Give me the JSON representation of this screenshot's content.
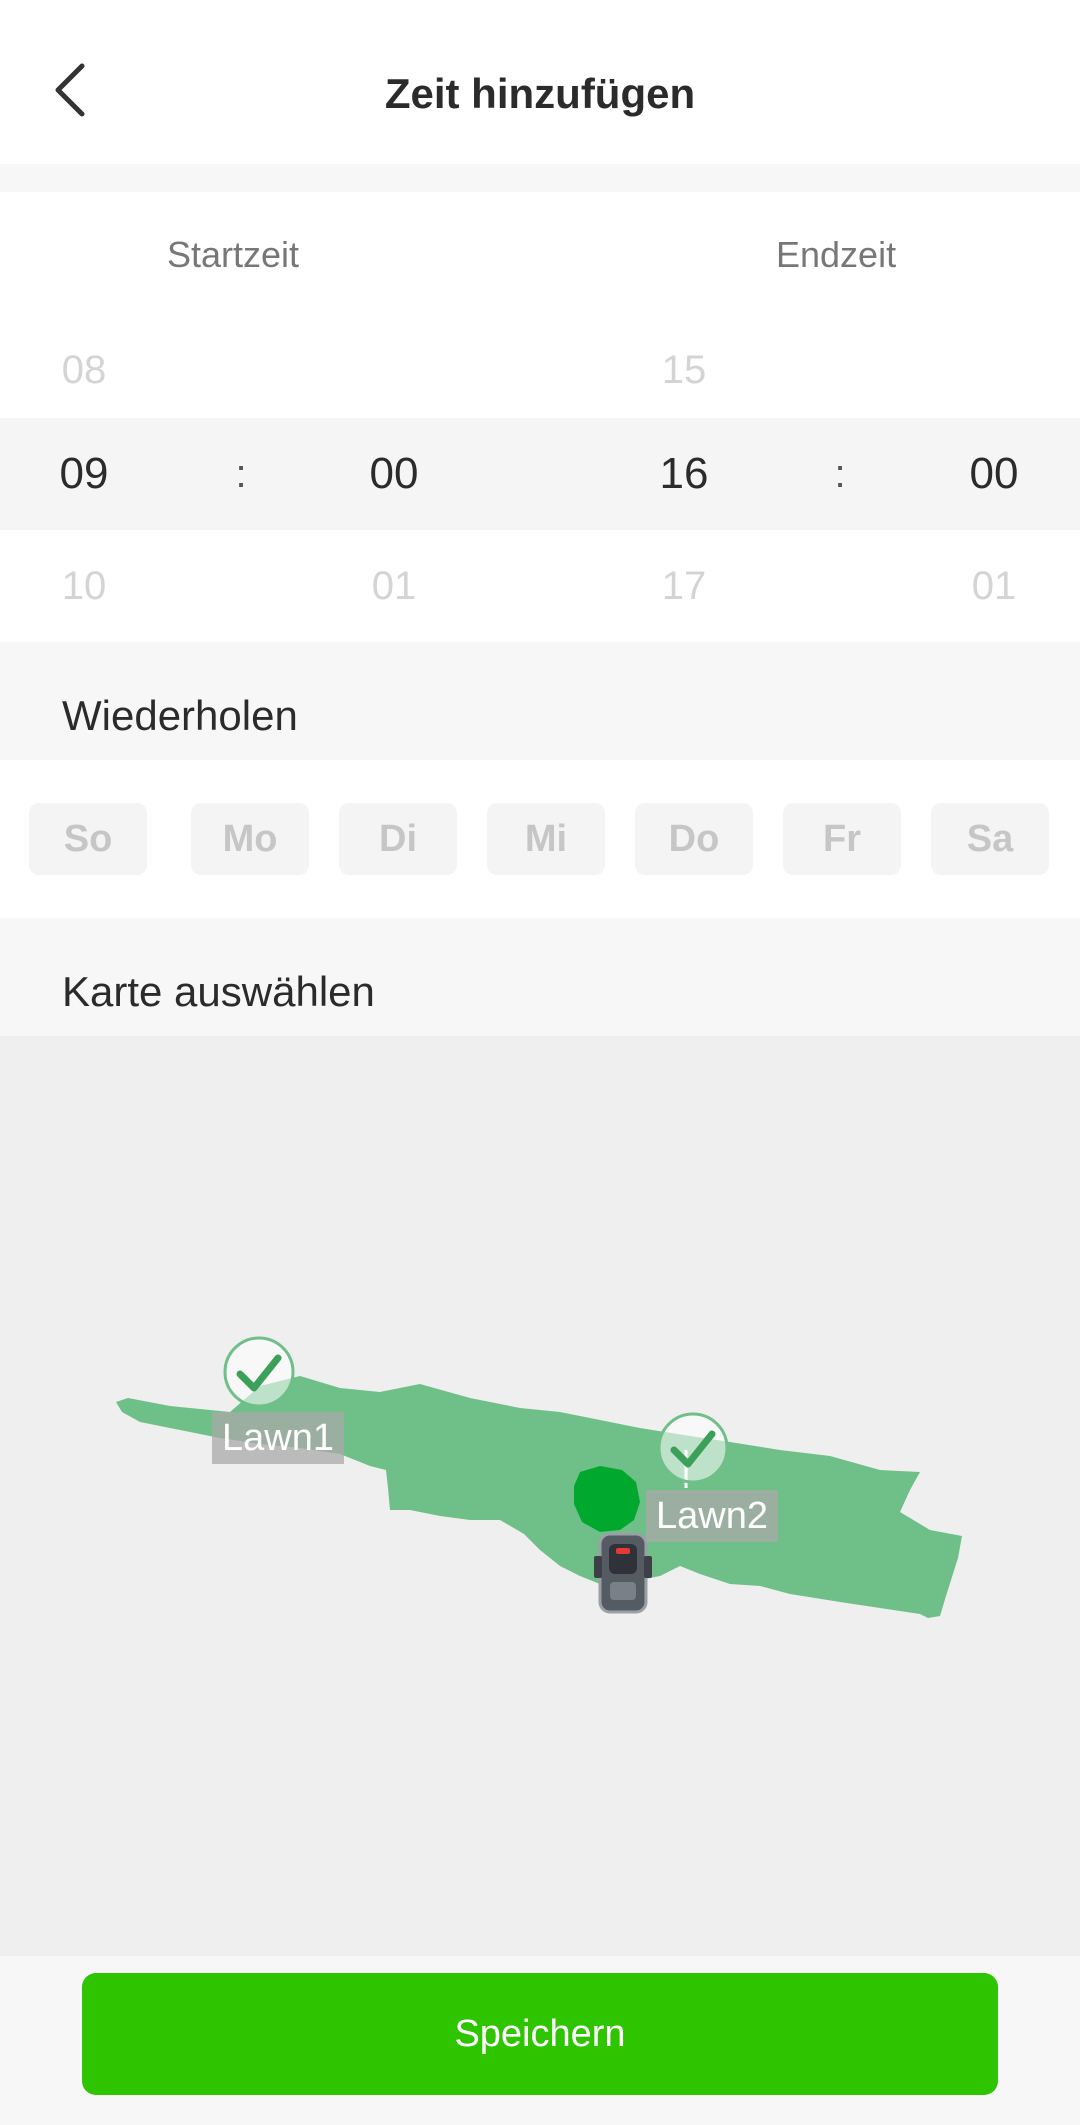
{
  "header": {
    "title": "Zeit hinzufügen"
  },
  "time": {
    "start_label": "Startzeit",
    "end_label": "Endzeit",
    "separator": ":",
    "start": {
      "hour_prev": "08",
      "hour": "09",
      "hour_next": "10",
      "minute": "00",
      "minute_next": "01"
    },
    "end": {
      "hour_prev": "15",
      "hour": "16",
      "hour_next": "17",
      "minute": "00",
      "minute_next": "01"
    }
  },
  "repeat": {
    "title": "Wiederholen",
    "days": [
      "So",
      "Mo",
      "Di",
      "Mi",
      "Do",
      "Fr",
      "Sa"
    ]
  },
  "map": {
    "title": "Karte auswählen",
    "lawns": [
      {
        "name": "Lawn1",
        "selected": true
      },
      {
        "name": "Lawn2",
        "selected": true
      }
    ],
    "colors": {
      "lawn": "#6fbf88",
      "mower_base": "#00a82d",
      "check": "#3aa05a"
    }
  },
  "footer": {
    "save_label": "Speichern"
  },
  "colors": {
    "accent": "#2ec500"
  }
}
